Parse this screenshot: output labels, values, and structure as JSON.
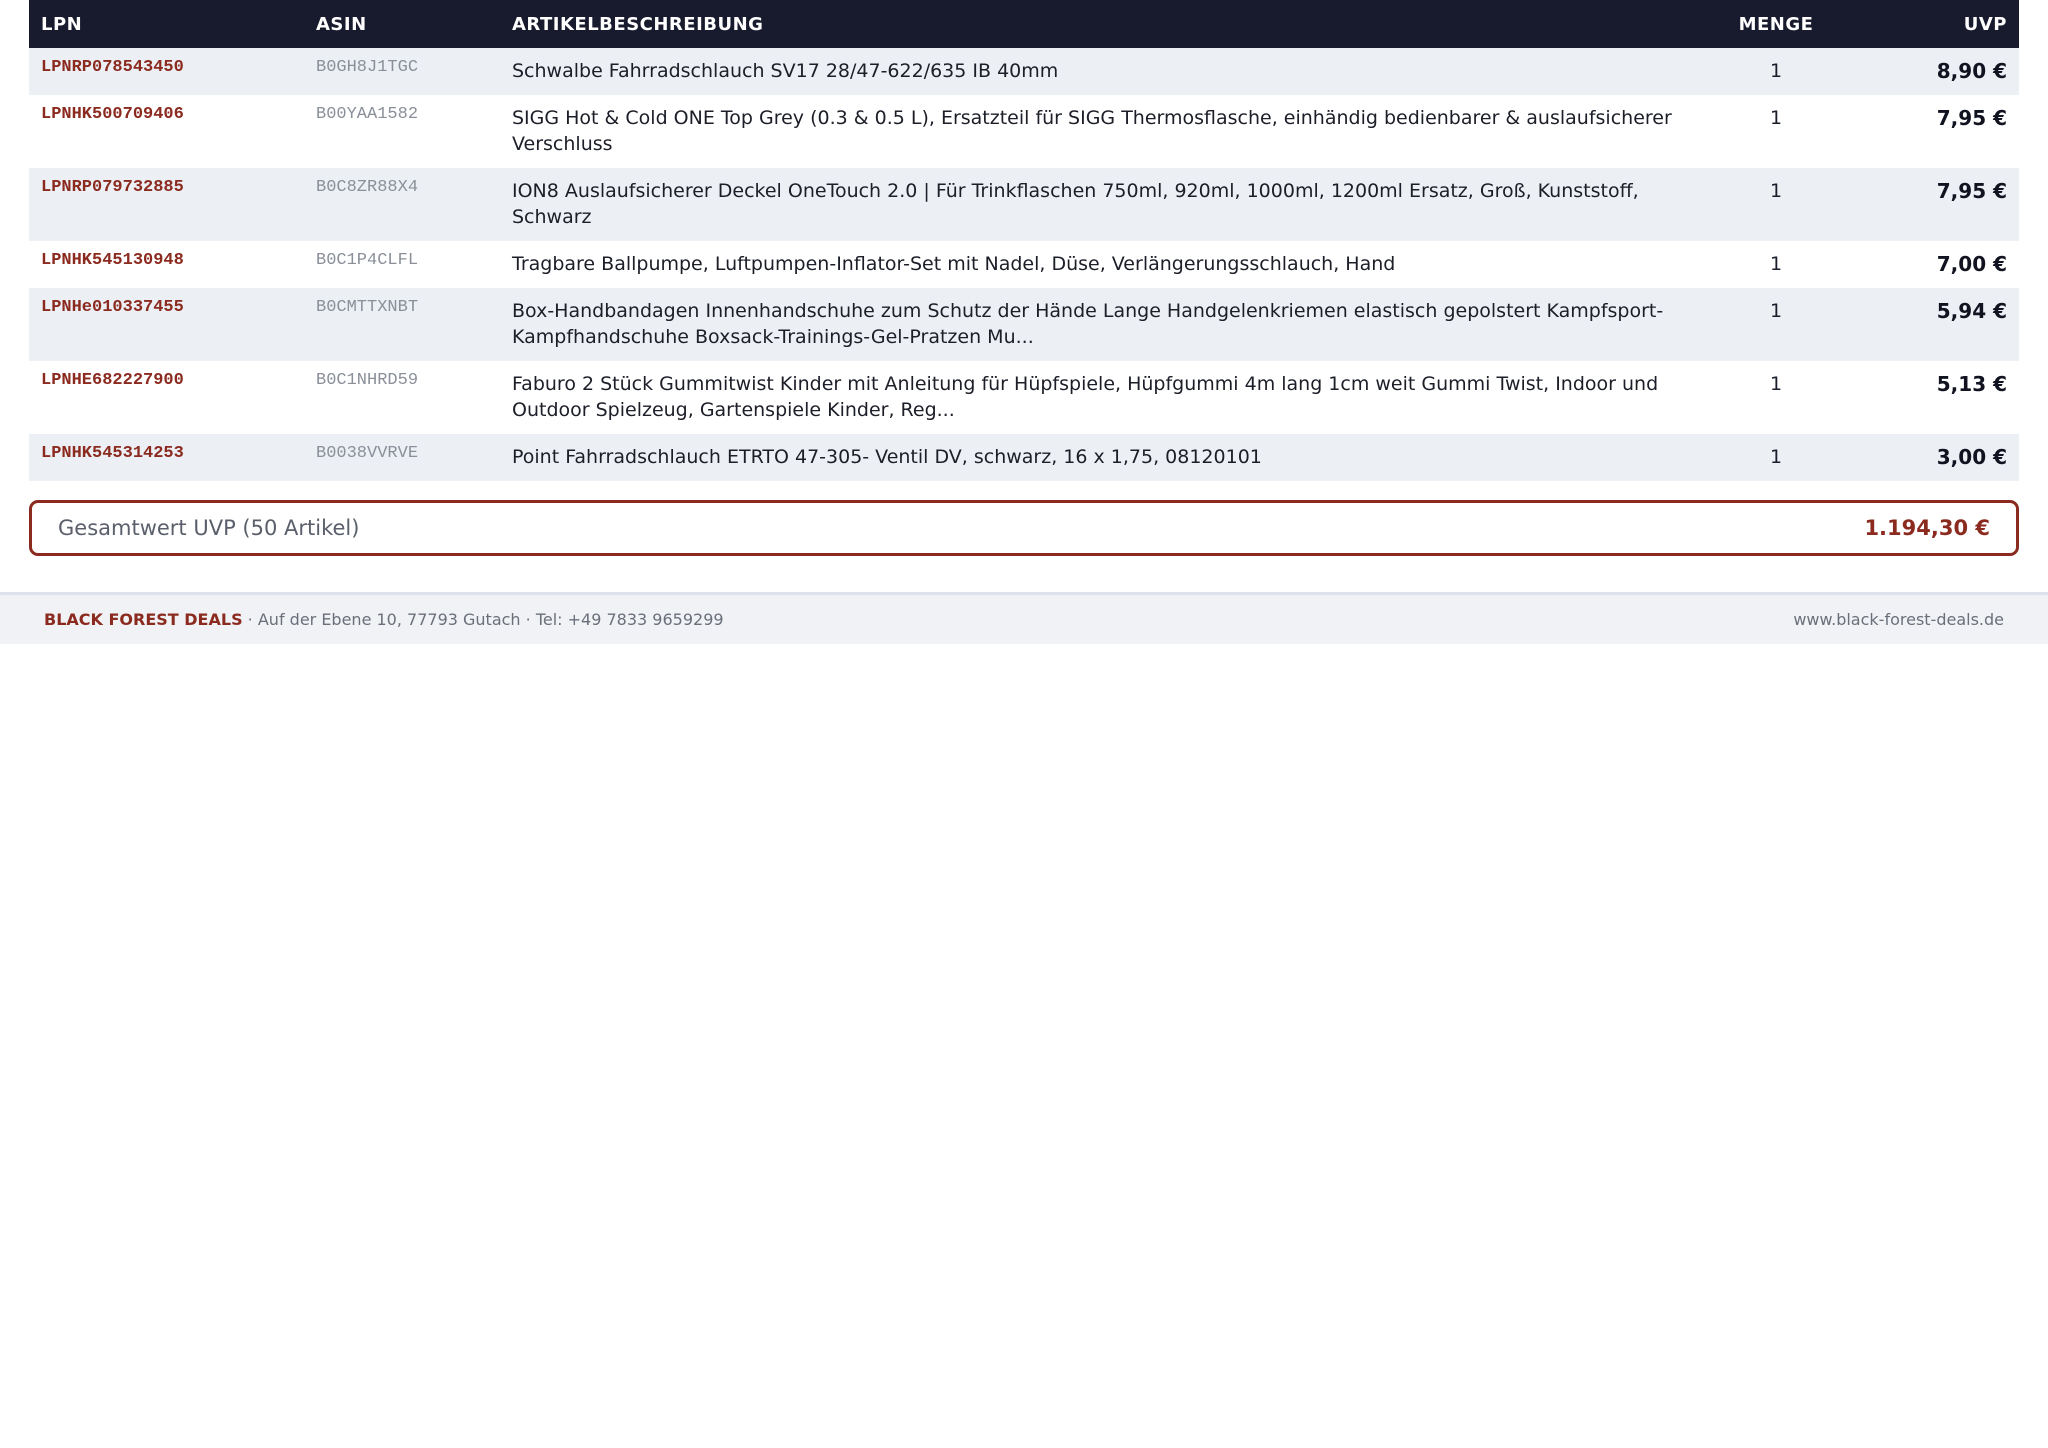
{
  "table": {
    "headers": {
      "lpn": "LPN",
      "asin": "ASIN",
      "description": "ARTIKELBESCHREIBUNG",
      "quantity": "MENGE",
      "uvp": "UVP"
    },
    "rows": [
      {
        "lpn": "LPNRP078543450",
        "asin": "B0GH8J1TGC",
        "description": "Schwalbe Fahrradschlauch SV17 28/47-622/635 IB 40mm",
        "quantity": "1",
        "uvp": "8,90 €"
      },
      {
        "lpn": "LPNHK500709406",
        "asin": "B00YAA1582",
        "description": "SIGG Hot & Cold ONE Top Grey (0.3 & 0.5 L), Ersatzteil für SIGG Thermosflasche, einhändig bedienbarer & auslaufsicherer Verschluss",
        "quantity": "1",
        "uvp": "7,95 €"
      },
      {
        "lpn": "LPNRP079732885",
        "asin": "B0C8ZR88X4",
        "description": "ION8 Auslaufsicherer Deckel OneTouch 2.0 | Für Trinkflaschen 750ml, 920ml, 1000ml, 1200ml Ersatz, Groß, Kunststoff, Schwarz",
        "quantity": "1",
        "uvp": "7,95 €"
      },
      {
        "lpn": "LPNHK545130948",
        "asin": "B0C1P4CLFL",
        "description": "Tragbare Ballpumpe, Luftpumpen-Inflator-Set mit Nadel, Düse, Verlängerungsschlauch, Hand",
        "quantity": "1",
        "uvp": "7,00 €"
      },
      {
        "lpn": "LPNHe010337455",
        "asin": "B0CMTTXNBT",
        "description": "Box-Handbandagen Innenhandschuhe zum Schutz der Hände Lange Handgelenkriemen elastisch gepolstert Kampfsport-Kampfhandschuhe Boxsack-Trainings-Gel-Pratzen Mu...",
        "quantity": "1",
        "uvp": "5,94 €"
      },
      {
        "lpn": "LPNHE682227900",
        "asin": "B0C1NHRD59",
        "description": "Faburo 2 Stück Gummitwist Kinder mit Anleitung für Hüpfspiele, Hüpfgummi 4m lang 1cm weit Gummi Twist, Indoor und Outdoor Spielzeug, Gartenspiele Kinder, Reg...",
        "quantity": "1",
        "uvp": "5,13 €"
      },
      {
        "lpn": "LPNHK545314253",
        "asin": "B0038VVRVE",
        "description": "Point Fahrradschlauch ETRTO 47-305- Ventil DV, schwarz, 16 x 1,75, 08120101",
        "quantity": "1",
        "uvp": "3,00 €"
      }
    ]
  },
  "summary": {
    "label": "Gesamtwert UVP (50 Artikel)",
    "value": "1.194,30 €"
  },
  "footer": {
    "brand": "BLACK FOREST DEALS",
    "address": " · Auf der Ebene 10, 77793 Gutach · Tel: +49 7833 9659299",
    "website": "www.black-forest-deals.de"
  },
  "colors": {
    "header_bg": "#181b2d",
    "accent": "#8b2a1f",
    "row_alt_bg": "#ecf0f5",
    "footer_bg": "#f0f2f6"
  }
}
